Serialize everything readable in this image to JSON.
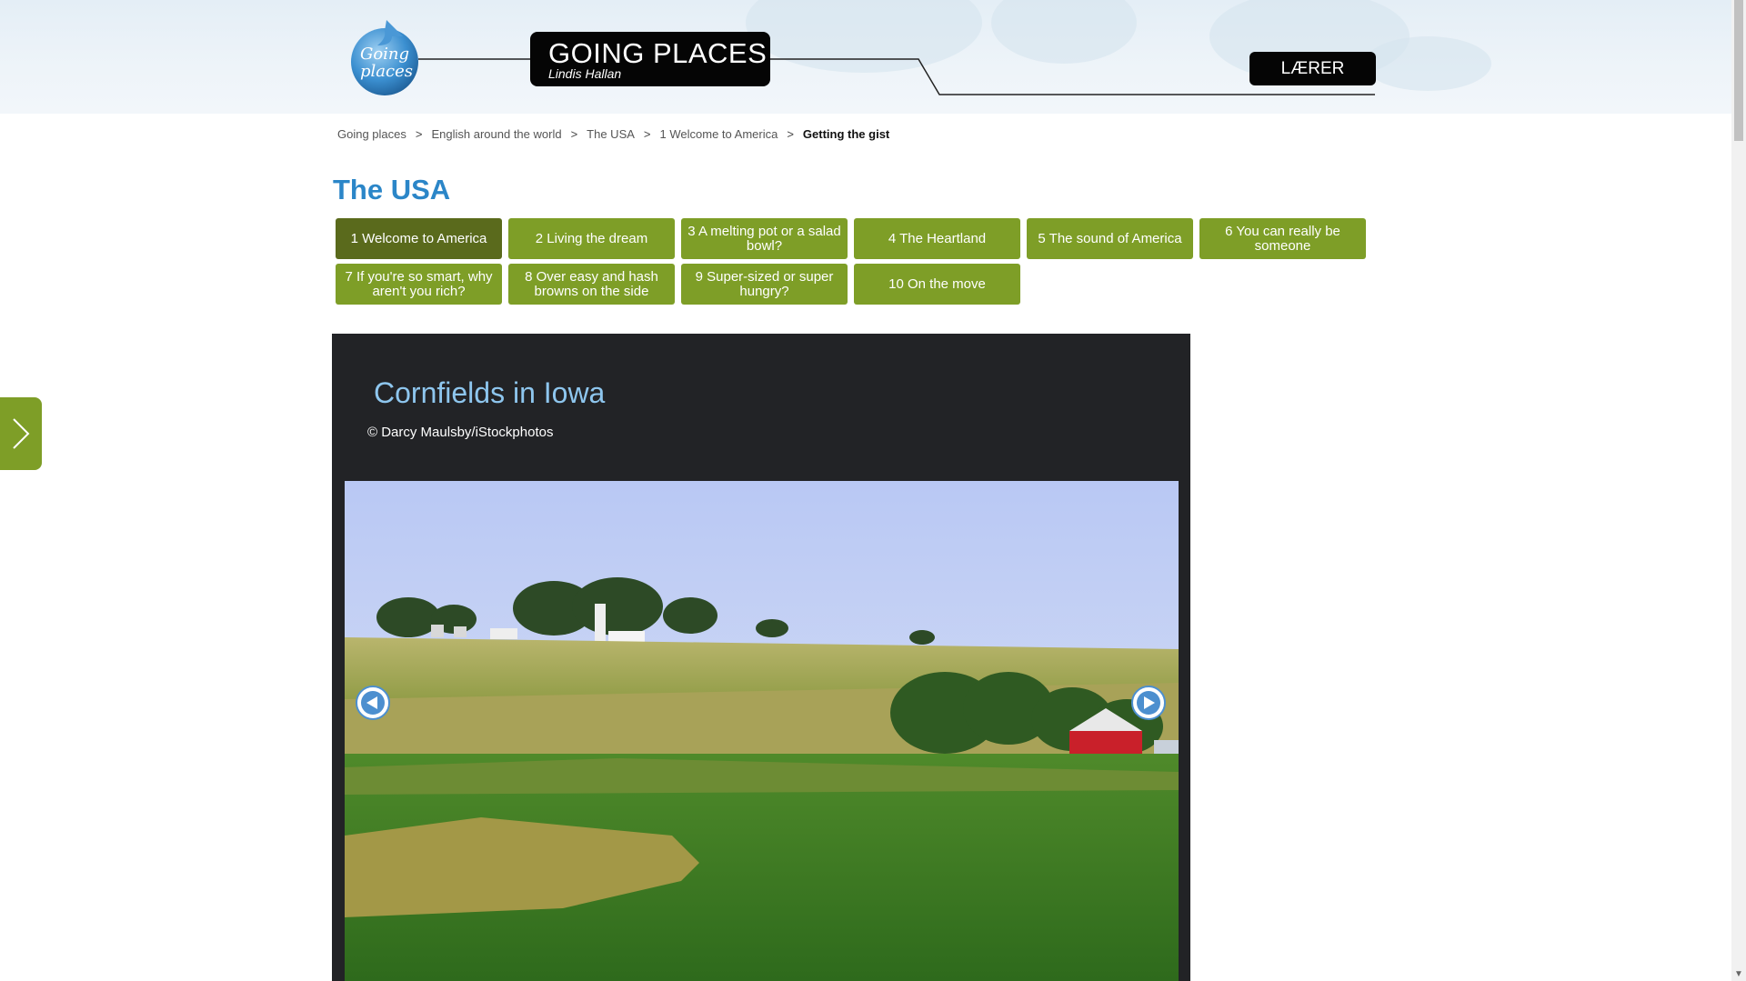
{
  "header": {
    "logo_text_line1": "Going",
    "logo_text_line2": "places",
    "title": "GOING PLACES",
    "author": "Lindis Hallan",
    "role_button": "LÆRER"
  },
  "breadcrumb": {
    "items": [
      "Going places",
      "English around the world",
      "The USA",
      "1 Welcome to America"
    ],
    "current": "Getting the gist",
    "separator": ">"
  },
  "page_title": "The USA",
  "chapters": [
    {
      "label": "1 Welcome to America",
      "active": true
    },
    {
      "label": "2 Living the dream",
      "active": false
    },
    {
      "label": "3 A melting pot or a salad bowl?",
      "active": false
    },
    {
      "label": "4 The Heartland",
      "active": false
    },
    {
      "label": "5 The sound of America",
      "active": false
    },
    {
      "label": "6 You can really be someone",
      "active": false
    },
    {
      "label": "7 If you're so smart, why aren't you rich?",
      "active": false
    },
    {
      "label": "8 Over easy and hash browns on the side",
      "active": false
    },
    {
      "label": "9 Super-sized or super hungry?",
      "active": false
    },
    {
      "label": "10 On the move",
      "active": false
    }
  ],
  "slide": {
    "title": "Cornfields in Iowa",
    "credit": "© Darcy Maulsby/iStockphotos"
  },
  "colors": {
    "chapter_green": "#7e9e27",
    "chapter_active": "#5a6a1c",
    "title_blue": "#2b86c8",
    "panel_dark": "#222326",
    "slide_title": "#8ec6ee"
  },
  "icons": {
    "side_tab": "chevron-right-icon",
    "prev": "arrow-left-circle-icon",
    "next": "arrow-right-circle-icon"
  }
}
